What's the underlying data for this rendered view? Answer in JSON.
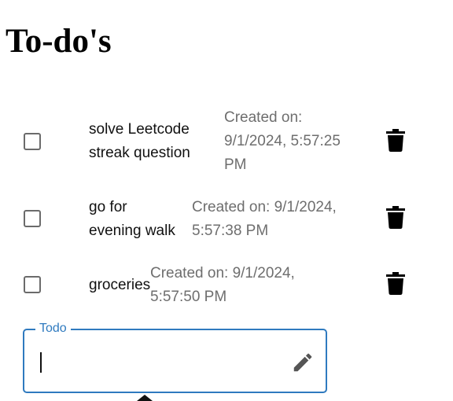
{
  "page": {
    "title": "To-do's"
  },
  "todos": [
    {
      "text_lines": [
        "solve Leetcode",
        "streak question"
      ],
      "created_lines": [
        "Created on:",
        "9/1/2024, 5:57:25",
        "PM"
      ],
      "checked": false
    },
    {
      "text_lines": [
        "go for",
        "evening walk"
      ],
      "created_lines": [
        "Created on: 9/1/2024,",
        "5:57:38 PM"
      ],
      "checked": false
    },
    {
      "text_lines": [
        "groceries"
      ],
      "created_lines": [
        "Created on: 9/1/2024,",
        "5:57:50 PM"
      ],
      "checked": false
    }
  ],
  "new_todo": {
    "label": "Todo",
    "value": "",
    "submit_icon": "pencil-icon"
  },
  "icons": {
    "delete": "trash-icon",
    "checkbox": "checkbox-unchecked"
  },
  "colors": {
    "accent": "#2f7abf",
    "timestamp": "#6e6e6e",
    "checkbox_border": "#6b6b6b",
    "icon": "#000000",
    "pencil": "#555555"
  }
}
